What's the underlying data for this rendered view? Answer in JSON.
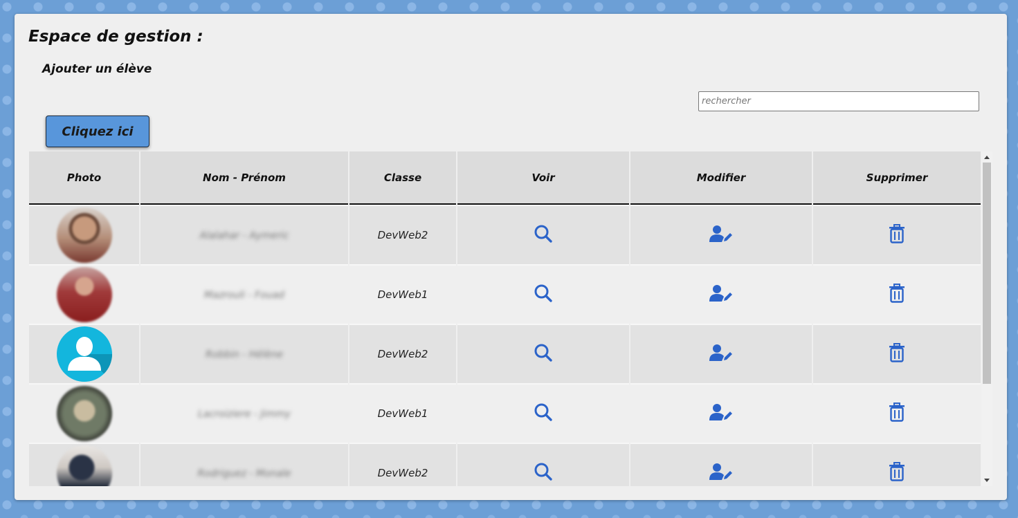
{
  "page": {
    "title": "Espace de gestion :",
    "subtitle": "Ajouter un élève",
    "add_button_label": "Cliquez ici",
    "search_placeholder": "rechercher"
  },
  "table": {
    "columns": [
      "Photo",
      "Nom - Prénom",
      "Classe",
      "Voir",
      "Modifier",
      "Supprimer"
    ],
    "rows": [
      {
        "name": "Alalahar - Aymeric",
        "class": "DevWeb2",
        "photo": "photo-portrait"
      },
      {
        "name": "Mazrouli - Fouad",
        "class": "DevWeb1",
        "photo": "photo-portrait"
      },
      {
        "name": "Robbin - Hélène",
        "class": "DevWeb2",
        "photo": "default-user-avatar"
      },
      {
        "name": "Lacroiziere - Jimmy",
        "class": "DevWeb1",
        "photo": "photo-portrait"
      },
      {
        "name": "Rodriguez - Monale",
        "class": "DevWeb2",
        "photo": "photo-portrait"
      }
    ]
  },
  "icons": {
    "view": "search-icon",
    "edit": "user-edit-icon",
    "delete": "trash-icon"
  },
  "colors": {
    "accent": "#2b63c9",
    "button": "#5896db",
    "background": "#6c9fd6",
    "panel": "#efefef"
  }
}
